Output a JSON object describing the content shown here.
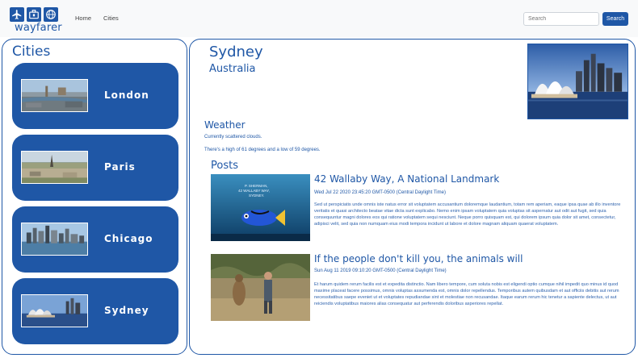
{
  "brand": {
    "name": "wayfarer",
    "icons": [
      "airplane-icon",
      "suitcase-icon",
      "globe-icon"
    ]
  },
  "nav": {
    "items": [
      {
        "label": "Home"
      },
      {
        "label": "Cities"
      }
    ]
  },
  "search": {
    "placeholder": "Search",
    "value": "",
    "button_label": "Search"
  },
  "sidebar": {
    "title": "Cities",
    "cities": [
      {
        "name": "London"
      },
      {
        "name": "Paris"
      },
      {
        "name": "Chicago"
      },
      {
        "name": "Sydney"
      }
    ]
  },
  "city": {
    "name": "Sydney",
    "country": "Australia"
  },
  "weather": {
    "heading": "Weather",
    "summary": "Currently scattered clouds.",
    "range": "There's a high of 61 degrees and a low of 59 degrees."
  },
  "posts": {
    "heading": "Posts",
    "items": [
      {
        "title": "42 Wallaby Way, A National Landmark",
        "date": "Wed Jul 22 2020 23:45:20 GMT-0500 (Central Daylight Time)",
        "image_caption": "P. SHERMAN, 42 WALLABY WAY, SYDNEY.",
        "body": "Sed ut perspiciatis unde omnis iste natus error sit voluptatem accusantium doloremque laudantium, totam rem aperiam, eaque ipsa quae ab illo inventore veritatis et quasi architecto beatae vitae dicta sunt explicabo. Nemo enim ipsam voluptatem quia voluptas sit aspernatur aut odit aut fugit, sed quia consequuntur magni dolores eos qui ratione voluptatem sequi nesciunt. Neque porro quisquam est, qui dolorem ipsum quia dolor sit amet, consectetur, adipisci velit, sed quia non numquam eius modi tempora incidunt ut labore et dolore magnam aliquam quaerat voluptatem."
      },
      {
        "title": "If the people don't kill you, the animals will",
        "date": "Sun Aug 11 2019 09:10:20 GMT-0500 (Central Daylight Time)",
        "body": "Et harum quidem rerum facilis est et expedita distinctio. Nam libero tempore, cum soluta nobis est eligendi optio cumque nihil impedit quo minus id quod maxime placeat facere possimus, omnis voluptas assumenda est, omnis dolor repellendus. Temporibus autem quibusdam et aut officiis debitis aut rerum necessitatibus saepe eveniet ut et voluptates repudiandae sint et molestiae non recusandae. Itaque earum rerum hic tenetur a sapiente delectus, ut aut reiciendis voluptatibus maiores alias consequatur aut perferendis doloribus asperiores repellat."
      }
    ]
  },
  "colors": {
    "accent": "#1f57a6",
    "navbar_bg": "#f8f9fa"
  }
}
